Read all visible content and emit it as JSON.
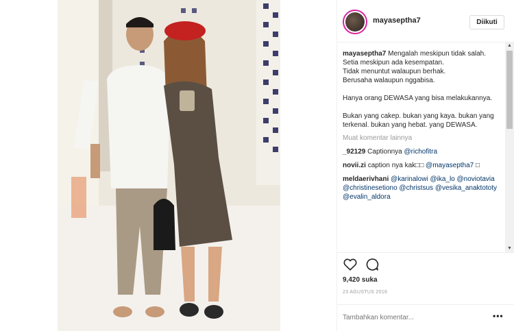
{
  "header": {
    "username": "mayaseptha7",
    "follow_label": "Diikuti"
  },
  "caption": {
    "username": "mayaseptha7",
    "text": "Mengalah meskipun tidak salah.\nSetia meskipun ada kesempatan.\nTidak menuntut walaupun berhak.\nBerusaha walaupun nggabisa.\n\nHanya orang DEWASA yang bisa melakukannya.\n\nBukan yang cakep. bukan yang kaya. bukan yang terkenal. bukan yang hebat. yang DEWASA."
  },
  "load_more_label": "Muat komentar lainnya",
  "comments": [
    {
      "username": "_92129",
      "text": "Captionnya",
      "mentions": [
        "@richofitra"
      ]
    },
    {
      "username": "novii.zi",
      "text": "caption nya kak□□",
      "mentions": [
        "@mayaseptha7"
      ],
      "suffix": "□"
    },
    {
      "username": "meldaerivhani",
      "text": "",
      "mentions": [
        "@karinalowi",
        "@ika_lo",
        "@noviotavia",
        "@christinesetiono",
        "@christsus",
        "@vesika_anaktototy",
        "@evalin_aldora"
      ]
    }
  ],
  "likes": "9,420 suka",
  "date": "23 AGUSTUS 2016",
  "add_comment": {
    "placeholder": "Tambahkan komentar..."
  },
  "icons": {
    "like": "heart-icon",
    "comment": "comment-icon",
    "more": "more-options-icon"
  },
  "colors": {
    "mention": "#003569",
    "muted": "#999999",
    "border": "#efefef"
  }
}
